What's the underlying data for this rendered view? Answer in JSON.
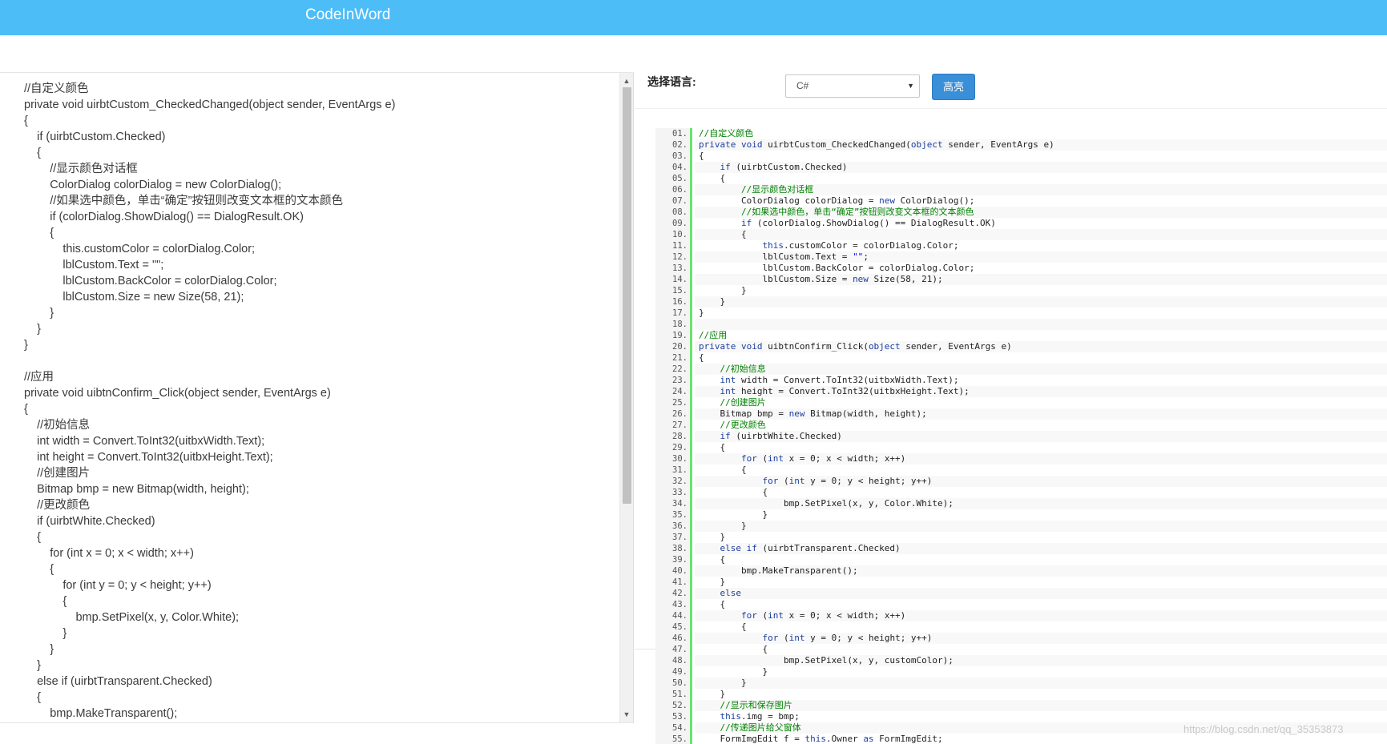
{
  "header": {
    "title": "CodeInWord"
  },
  "toolbar": {
    "language_label": "选择语言:",
    "language_value": "C#",
    "highlight_button": "高亮"
  },
  "editor": {
    "lines": [
      "//自定义颜色",
      "private void uirbtCustom_CheckedChanged(object sender, EventArgs e)",
      "{",
      "    if (uirbtCustom.Checked)",
      "    {",
      "        //显示颜色对话框",
      "        ColorDialog colorDialog = new ColorDialog();",
      "        //如果选中颜色，单击“确定”按钮则改变文本框的文本颜色",
      "        if (colorDialog.ShowDialog() == DialogResult.OK)",
      "        {",
      "            this.customColor = colorDialog.Color;",
      "            lblCustom.Text = \"\";",
      "            lblCustom.BackColor = colorDialog.Color;",
      "            lblCustom.Size = new Size(58, 21);",
      "        }",
      "    }",
      "}",
      "",
      "//应用",
      "private void uibtnConfirm_Click(object sender, EventArgs e)",
      "{",
      "    //初始信息",
      "    int width = Convert.ToInt32(uitbxWidth.Text);",
      "    int height = Convert.ToInt32(uitbxHeight.Text);",
      "    //创建图片",
      "    Bitmap bmp = new Bitmap(width, height);",
      "    //更改颜色",
      "    if (uirbtWhite.Checked)",
      "    {",
      "        for (int x = 0; x < width; x++)",
      "        {",
      "            for (int y = 0; y < height; y++)",
      "            {",
      "                bmp.SetPixel(x, y, Color.White);",
      "            }",
      "        }",
      "    }",
      "    else if (uirbtTransparent.Checked)",
      "    {",
      "        bmp.MakeTransparent();"
    ]
  },
  "highlighted": {
    "lines": [
      {
        "no": "01.",
        "segs": [
          [
            "c",
            "//自定义颜色"
          ]
        ]
      },
      {
        "no": "02.",
        "segs": [
          [
            "k",
            "private void"
          ],
          [
            "t",
            " uirbtCustom_CheckedChanged("
          ],
          [
            "k",
            "object"
          ],
          [
            "t",
            " sender, EventArgs e)"
          ]
        ]
      },
      {
        "no": "03.",
        "segs": [
          [
            "t",
            "{"
          ]
        ]
      },
      {
        "no": "04.",
        "segs": [
          [
            "t",
            "    "
          ],
          [
            "k",
            "if"
          ],
          [
            "t",
            " (uirbtCustom.Checked)"
          ]
        ]
      },
      {
        "no": "05.",
        "segs": [
          [
            "t",
            "    {"
          ]
        ]
      },
      {
        "no": "06.",
        "segs": [
          [
            "t",
            "        "
          ],
          [
            "c",
            "//显示颜色对话框"
          ]
        ]
      },
      {
        "no": "07.",
        "segs": [
          [
            "t",
            "        ColorDialog colorDialog = "
          ],
          [
            "k",
            "new"
          ],
          [
            "t",
            " ColorDialog();"
          ]
        ]
      },
      {
        "no": "08.",
        "segs": [
          [
            "t",
            "        "
          ],
          [
            "c",
            "//如果选中颜色，单击“确定”按钮则改变文本框的文本颜色"
          ]
        ]
      },
      {
        "no": "09.",
        "segs": [
          [
            "t",
            "        "
          ],
          [
            "k",
            "if"
          ],
          [
            "t",
            " (colorDialog.ShowDialog() == DialogResult.OK)"
          ]
        ]
      },
      {
        "no": "10.",
        "segs": [
          [
            "t",
            "        {"
          ]
        ]
      },
      {
        "no": "11.",
        "segs": [
          [
            "t",
            "            "
          ],
          [
            "k",
            "this"
          ],
          [
            "t",
            ".customColor = colorDialog.Color;"
          ]
        ]
      },
      {
        "no": "12.",
        "segs": [
          [
            "t",
            "            lblCustom.Text = "
          ],
          [
            "s",
            "\"\""
          ],
          [
            "t",
            ";"
          ]
        ]
      },
      {
        "no": "13.",
        "segs": [
          [
            "t",
            "            lblCustom.BackColor = colorDialog.Color;"
          ]
        ]
      },
      {
        "no": "14.",
        "segs": [
          [
            "t",
            "            lblCustom.Size = "
          ],
          [
            "k",
            "new"
          ],
          [
            "t",
            " Size(58, 21);"
          ]
        ]
      },
      {
        "no": "15.",
        "segs": [
          [
            "t",
            "        }"
          ]
        ]
      },
      {
        "no": "16.",
        "segs": [
          [
            "t",
            "    }"
          ]
        ]
      },
      {
        "no": "17.",
        "segs": [
          [
            "t",
            "}"
          ]
        ]
      },
      {
        "no": "18.",
        "segs": [
          [
            "t",
            ""
          ]
        ]
      },
      {
        "no": "19.",
        "segs": [
          [
            "c",
            "//应用"
          ]
        ]
      },
      {
        "no": "20.",
        "segs": [
          [
            "k",
            "private void"
          ],
          [
            "t",
            " uibtnConfirm_Click("
          ],
          [
            "k",
            "object"
          ],
          [
            "t",
            " sender, EventArgs e)"
          ]
        ]
      },
      {
        "no": "21.",
        "segs": [
          [
            "t",
            "{"
          ]
        ]
      },
      {
        "no": "22.",
        "segs": [
          [
            "t",
            "    "
          ],
          [
            "c",
            "//初始信息"
          ]
        ]
      },
      {
        "no": "23.",
        "segs": [
          [
            "t",
            "    "
          ],
          [
            "k",
            "int"
          ],
          [
            "t",
            " width = Convert.ToInt32(uitbxWidth.Text);"
          ]
        ]
      },
      {
        "no": "24.",
        "segs": [
          [
            "t",
            "    "
          ],
          [
            "k",
            "int"
          ],
          [
            "t",
            " height = Convert.ToInt32(uitbxHeight.Text);"
          ]
        ]
      },
      {
        "no": "25.",
        "segs": [
          [
            "t",
            "    "
          ],
          [
            "c",
            "//创建图片"
          ]
        ]
      },
      {
        "no": "26.",
        "segs": [
          [
            "t",
            "    Bitmap bmp = "
          ],
          [
            "k",
            "new"
          ],
          [
            "t",
            " Bitmap(width, height);"
          ]
        ]
      },
      {
        "no": "27.",
        "segs": [
          [
            "t",
            "    "
          ],
          [
            "c",
            "//更改颜色"
          ]
        ]
      },
      {
        "no": "28.",
        "segs": [
          [
            "t",
            "    "
          ],
          [
            "k",
            "if"
          ],
          [
            "t",
            " (uirbtWhite.Checked)"
          ]
        ]
      },
      {
        "no": "29.",
        "segs": [
          [
            "t",
            "    {"
          ]
        ]
      },
      {
        "no": "30.",
        "segs": [
          [
            "t",
            "        "
          ],
          [
            "k",
            "for"
          ],
          [
            "t",
            " ("
          ],
          [
            "k",
            "int"
          ],
          [
            "t",
            " x = 0; x < width; x++)"
          ]
        ]
      },
      {
        "no": "31.",
        "segs": [
          [
            "t",
            "        {"
          ]
        ]
      },
      {
        "no": "32.",
        "segs": [
          [
            "t",
            "            "
          ],
          [
            "k",
            "for"
          ],
          [
            "t",
            " ("
          ],
          [
            "k",
            "int"
          ],
          [
            "t",
            " y = 0; y < height; y++)"
          ]
        ]
      },
      {
        "no": "33.",
        "segs": [
          [
            "t",
            "            {"
          ]
        ]
      },
      {
        "no": "34.",
        "segs": [
          [
            "t",
            "                bmp.SetPixel(x, y, Color.White);"
          ]
        ]
      },
      {
        "no": "35.",
        "segs": [
          [
            "t",
            "            }"
          ]
        ]
      },
      {
        "no": "36.",
        "segs": [
          [
            "t",
            "        }"
          ]
        ]
      },
      {
        "no": "37.",
        "segs": [
          [
            "t",
            "    }"
          ]
        ]
      },
      {
        "no": "38.",
        "segs": [
          [
            "t",
            "    "
          ],
          [
            "k",
            "else if"
          ],
          [
            "t",
            " (uirbtTransparent.Checked)"
          ]
        ]
      },
      {
        "no": "39.",
        "segs": [
          [
            "t",
            "    {"
          ]
        ]
      },
      {
        "no": "40.",
        "segs": [
          [
            "t",
            "        bmp.MakeTransparent();"
          ]
        ]
      },
      {
        "no": "41.",
        "segs": [
          [
            "t",
            "    }"
          ]
        ]
      },
      {
        "no": "42.",
        "segs": [
          [
            "t",
            "    "
          ],
          [
            "k",
            "else"
          ]
        ]
      },
      {
        "no": "43.",
        "segs": [
          [
            "t",
            "    {"
          ]
        ]
      },
      {
        "no": "44.",
        "segs": [
          [
            "t",
            "        "
          ],
          [
            "k",
            "for"
          ],
          [
            "t",
            " ("
          ],
          [
            "k",
            "int"
          ],
          [
            "t",
            " x = 0; x < width; x++)"
          ]
        ]
      },
      {
        "no": "45.",
        "segs": [
          [
            "t",
            "        {"
          ]
        ]
      },
      {
        "no": "46.",
        "segs": [
          [
            "t",
            "            "
          ],
          [
            "k",
            "for"
          ],
          [
            "t",
            " ("
          ],
          [
            "k",
            "int"
          ],
          [
            "t",
            " y = 0; y < height; y++)"
          ]
        ]
      },
      {
        "no": "47.",
        "segs": [
          [
            "t",
            "            {"
          ]
        ]
      },
      {
        "no": "48.",
        "segs": [
          [
            "t",
            "                bmp.SetPixel(x, y, customColor);"
          ]
        ]
      },
      {
        "no": "49.",
        "segs": [
          [
            "t",
            "            }"
          ]
        ]
      },
      {
        "no": "50.",
        "segs": [
          [
            "t",
            "        }"
          ]
        ]
      },
      {
        "no": "51.",
        "segs": [
          [
            "t",
            "    }"
          ]
        ]
      },
      {
        "no": "52.",
        "segs": [
          [
            "t",
            "    "
          ],
          [
            "c",
            "//显示和保存图片"
          ]
        ]
      },
      {
        "no": "53.",
        "segs": [
          [
            "t",
            "    "
          ],
          [
            "k",
            "this"
          ],
          [
            "t",
            ".img = bmp;"
          ]
        ]
      },
      {
        "no": "54.",
        "segs": [
          [
            "t",
            "    "
          ],
          [
            "c",
            "//传递图片给父窗体"
          ]
        ]
      },
      {
        "no": "55.",
        "segs": [
          [
            "t",
            "    FormImgEdit f = "
          ],
          [
            "k",
            "this"
          ],
          [
            "t",
            ".Owner "
          ],
          [
            "k",
            "as"
          ],
          [
            "t",
            " FormImgEdit;"
          ]
        ]
      }
    ]
  },
  "colors": {
    "header_bg": "#4dbdf8",
    "button_bg": "#3a8fd9",
    "gutter_border": "#6ce26c",
    "keyword": "#1b3f9c",
    "comment": "#008200",
    "string": "#0000ff"
  },
  "watermark": "https://blog.csdn.net/qq_35353873"
}
